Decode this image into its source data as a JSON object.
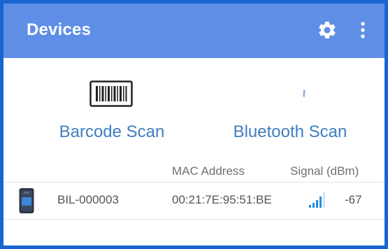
{
  "appbar": {
    "title": "Devices",
    "bg_color": "#5f8ee6",
    "icons": [
      "gear-icon",
      "more-vert-icon"
    ]
  },
  "scan_options": {
    "barcode": {
      "label": "Barcode Scan",
      "icon": "barcode-icon"
    },
    "bluetooth": {
      "label": "Bluetooth Scan",
      "icon": "bluetooth-icon"
    },
    "label_color": "#3f7fc0"
  },
  "table": {
    "headers": {
      "mac": "MAC Address",
      "signal": "Signal (dBm)"
    },
    "rows": [
      {
        "name": "BIL-000003",
        "mac": "00:21:7E:95:51:BE",
        "signal": "-67",
        "signal_bars_lit": 4,
        "icon": "device-icon"
      }
    ]
  },
  "accent_color": "#1a64cf"
}
